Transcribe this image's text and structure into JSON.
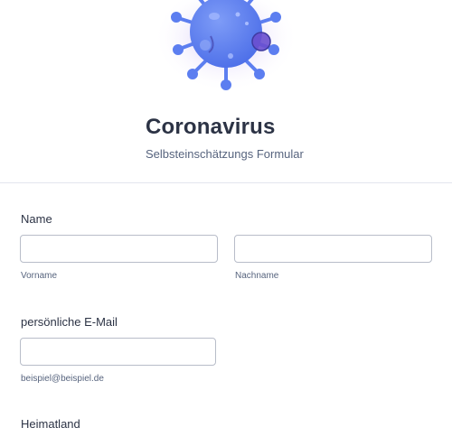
{
  "header": {
    "title": "Coronavirus",
    "subtitle": "Selbsteinschätzungs Formular",
    "illustration": "virus-icon",
    "colors": {
      "virus_body": "#5c7ef0",
      "virus_spot": "#7a5ad8",
      "glow": "#c9b6f5"
    }
  },
  "form": {
    "name": {
      "label": "Name",
      "first": {
        "value": "",
        "sublabel": "Vorname"
      },
      "last": {
        "value": "",
        "sublabel": "Nachname"
      }
    },
    "email": {
      "label": "persönliche E-Mail",
      "value": "",
      "sublabel": "beispiel@beispiel.de"
    },
    "country": {
      "label": "Heimatland"
    }
  }
}
